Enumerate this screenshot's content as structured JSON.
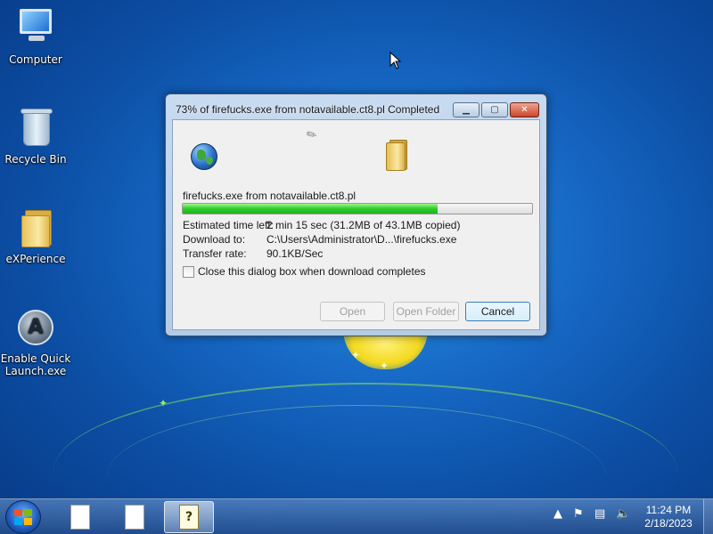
{
  "desktop": {
    "icons": [
      {
        "label": "Computer"
      },
      {
        "label": "Recycle Bin"
      },
      {
        "label": "eXPerience"
      },
      {
        "label": "Enable Quick Launch.exe"
      }
    ]
  },
  "dialog": {
    "title": "73% of firefucks.exe from notavailable.ct8.pl Completed",
    "file_line": "firefucks.exe from notavailable.ct8.pl",
    "progress_percent": 73,
    "rows": [
      {
        "label": "Estimated time left:",
        "value": "2 min 15 sec (31.2MB of 43.1MB copied)"
      },
      {
        "label": "Download to:",
        "value": "C:\\Users\\Administrator\\D...\\firefucks.exe"
      },
      {
        "label": "Transfer rate:",
        "value": "90.1KB/Sec"
      }
    ],
    "checkbox_label": "Close this dialog box when download completes",
    "checkbox_checked": false,
    "buttons": {
      "open": "Open",
      "open_folder": "Open Folder",
      "cancel": "Cancel"
    }
  },
  "taskbar": {
    "clock_time": "11:24 PM",
    "clock_date": "2/18/2023"
  },
  "colors": {
    "progress_fill": "#2ecc2a",
    "close_button": "#c9452a",
    "desktop_blue": "#1668c4"
  }
}
